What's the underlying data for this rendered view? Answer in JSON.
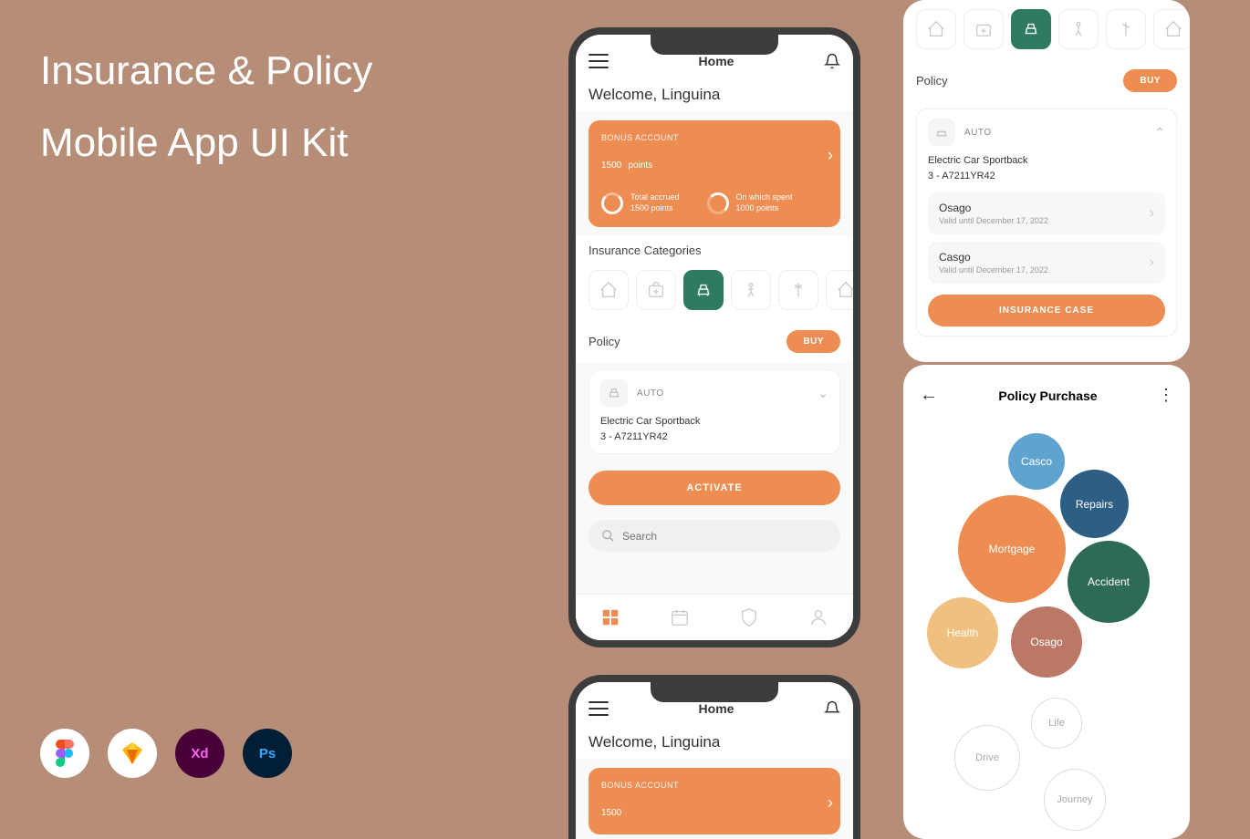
{
  "title_line1": "Insurance & Policy",
  "title_line2": "Mobile App UI Kit",
  "tools": [
    "Fg",
    "Sk",
    "Xd",
    "Ps"
  ],
  "phone1": {
    "header_title": "Home",
    "welcome": "Welcome, Linguina",
    "bonus_label": "BONUS ACCOUNT",
    "bonus_points": "1500",
    "bonus_unit": "points",
    "stat1_label": "Total accrued",
    "stat1_value": "1500 points",
    "stat2_label": "On which spent",
    "stat2_value": "1000 points",
    "categories_title": "Insurance Categories",
    "policy_title": "Policy",
    "buy": "BUY",
    "auto_label": "AUTO",
    "car_name": "Electric Car Sportback",
    "car_code": "3 - A7211YR42",
    "activate": "ACTIVATE",
    "search_placeholder": "Search"
  },
  "panel_policy": {
    "policy_title": "Policy",
    "buy": "BUY",
    "auto_label": "AUTO",
    "car_name": "Electric Car Sportback",
    "car_code": "3 - A7211YR42",
    "item1_name": "Osago",
    "item1_valid": "Valid until December 17, 2022",
    "item2_name": "Casgo",
    "item2_valid": "Valid until December 17, 2022",
    "insurance_case": "INSURANCE CASE"
  },
  "panel_purchase": {
    "title": "Policy Purchase",
    "bubbles": {
      "casco": "Casco",
      "repairs": "Repairs",
      "mortgage": "Mortgage",
      "accident": "Accident",
      "health": "Health",
      "osago": "Osago",
      "life": "Life",
      "drive": "Drive",
      "journey": "Journey"
    }
  },
  "phone_bottom": {
    "header_title": "Home",
    "welcome": "Welcome, Linguina",
    "bonus_label": "BONUS ACCOUNT",
    "bonus_points": "1500"
  }
}
